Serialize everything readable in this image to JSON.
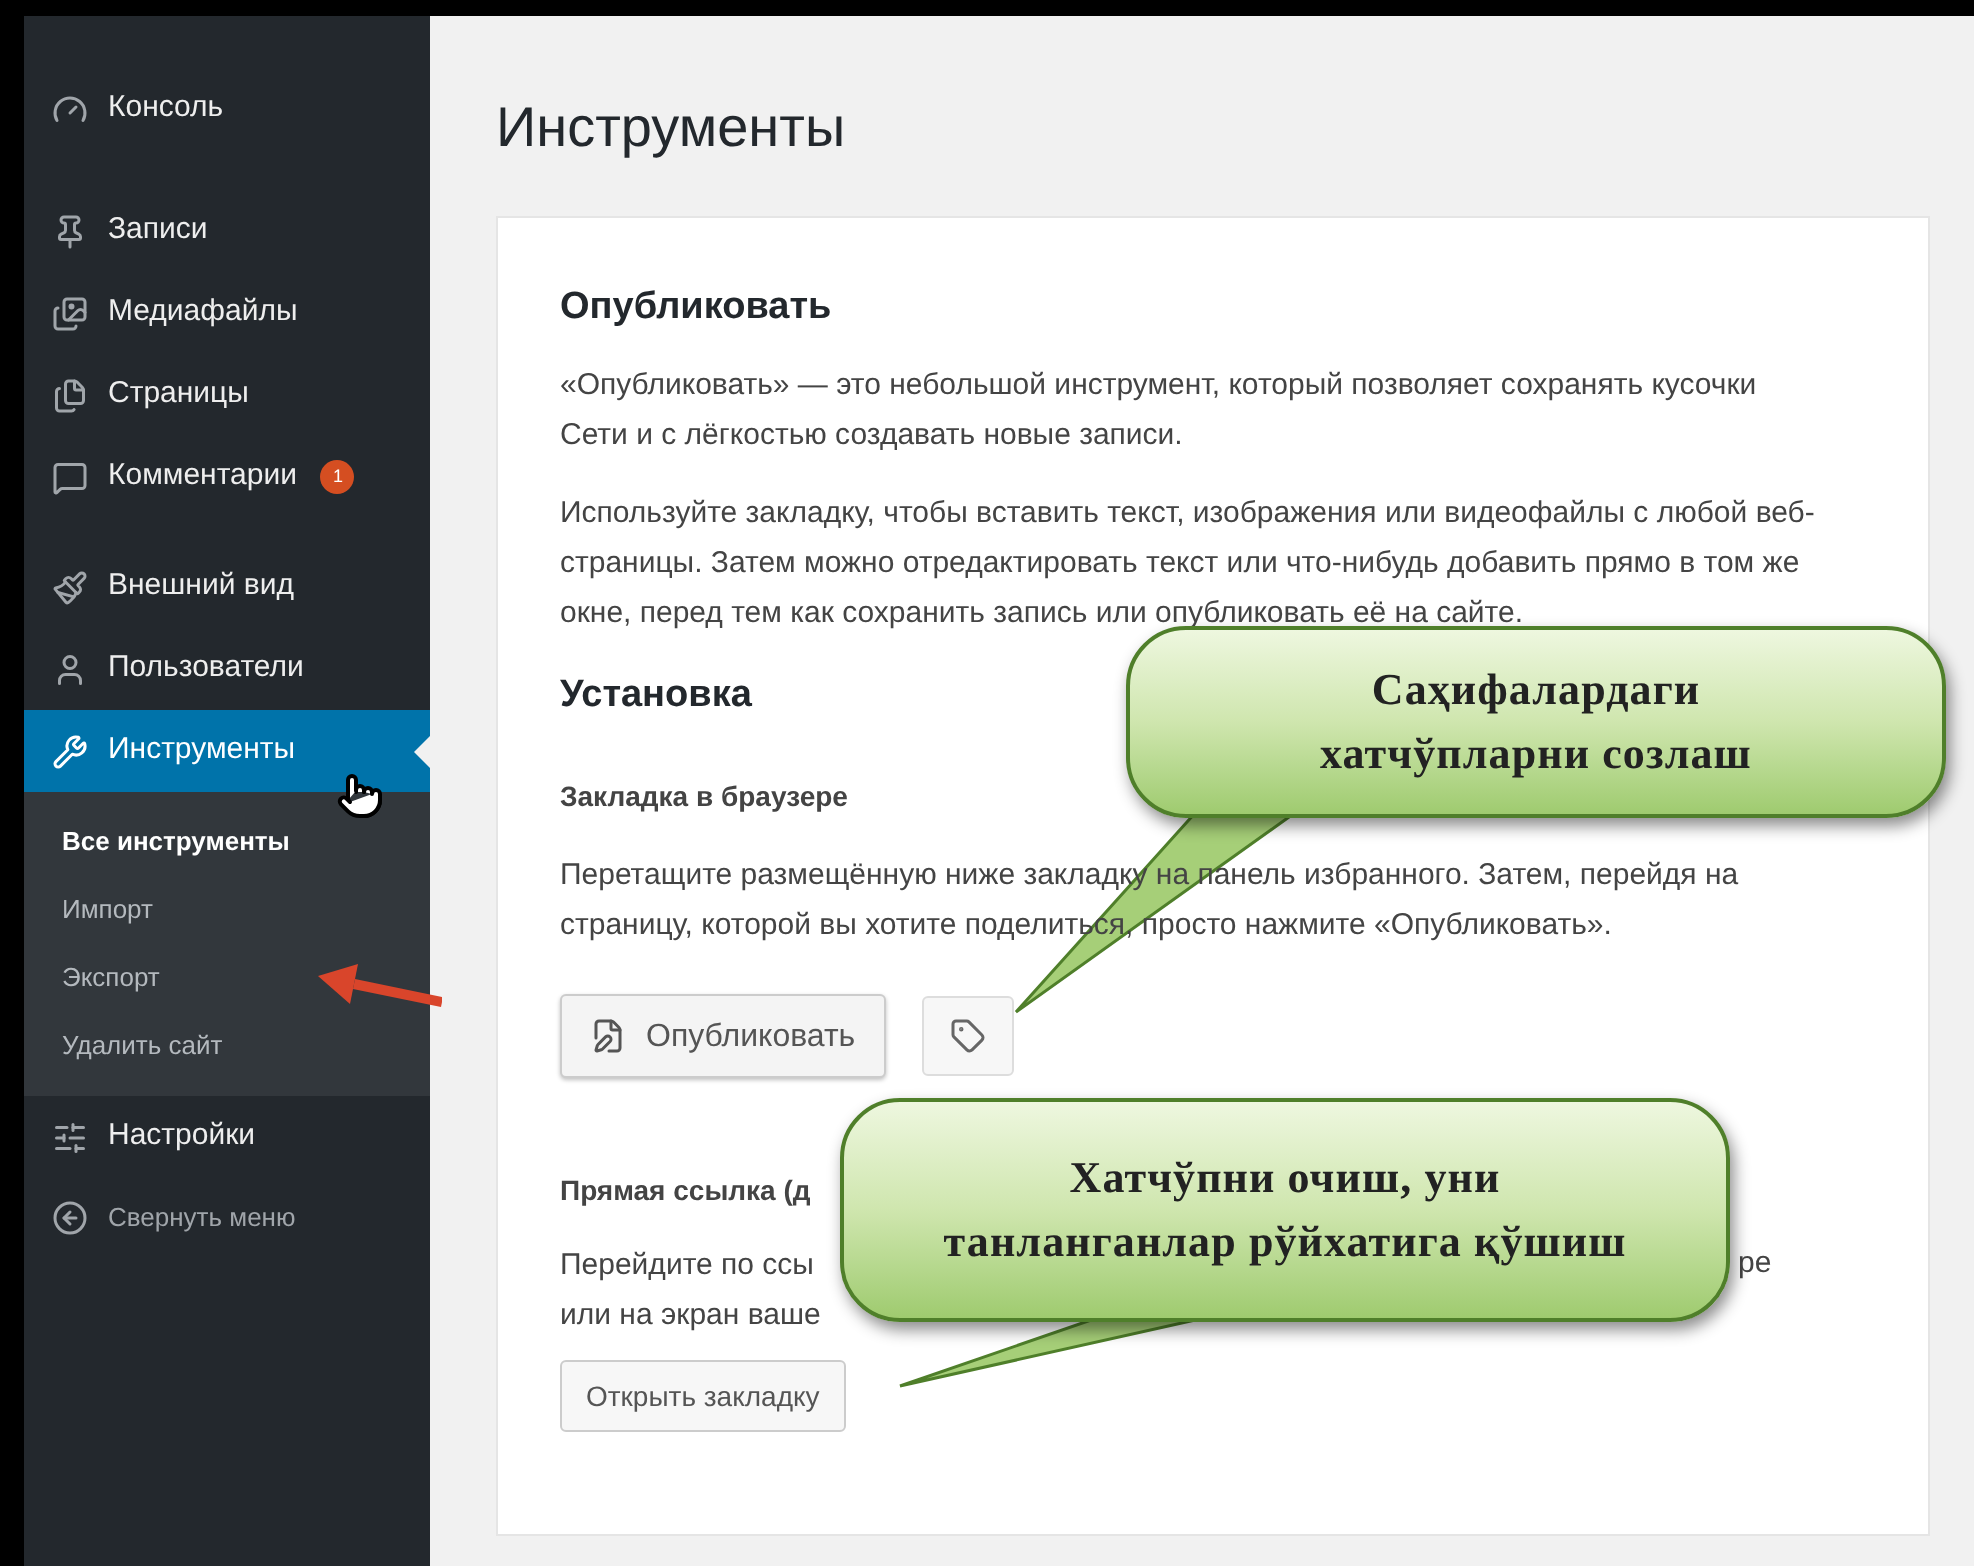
{
  "sidebar": {
    "items": [
      {
        "label": "Консоль",
        "selected": false
      },
      {
        "label": "Записи",
        "selected": false
      },
      {
        "label": "Медиафайлы",
        "selected": false
      },
      {
        "label": "Страницы",
        "selected": false
      },
      {
        "label": "Комментарии",
        "selected": false,
        "badge": "1"
      },
      {
        "label": "Внешний вид",
        "selected": false
      },
      {
        "label": "Пользователи",
        "selected": false
      },
      {
        "label": "Инструменты",
        "selected": true,
        "children": [
          {
            "label": "Все инструменты",
            "selected": true
          },
          {
            "label": "Импорт",
            "selected": false
          },
          {
            "label": "Экспорт",
            "selected": false
          },
          {
            "label": "Удалить сайт",
            "selected": false
          }
        ]
      },
      {
        "label": "Настройки",
        "selected": false
      }
    ],
    "collapse": "Свернуть меню"
  },
  "page_title": "Инструменты",
  "publish": {
    "heading": "Опубликовать",
    "paragraphs": [
      "«Опубликовать» — это небольшой инструмент, который позволяет сохранять кусочки Сети и с лёгкостью создавать новые записи.",
      "Используйте закладку, чтобы вставить текст, изображения или видеофайлы с любой веб-страницы. Затем можно отредактировать текст или что-нибудь добавить прямо в том же окне, перед тем как сохранить запись или опубликовать её на сайте."
    ]
  },
  "install": {
    "heading": "Установка",
    "bookmarklet": {
      "heading": "Закладка в браузере",
      "text": "Перетащите размещённую ниже закладку на панель избранного. Затем, перейдя на страницу, которой вы хотите поделиться, просто нажмите «Опубликовать».",
      "button": "Опубликовать"
    },
    "direct_link": {
      "heading": "Прямая ссылка (д",
      "lines": [
        "Перейдите по ссы",
        "или на экран ваше"
      ],
      "line_end": "ре",
      "button": "Открыть закладку"
    }
  },
  "callouts": [
    {
      "lines": [
        "Саҳифалардаги",
        "хатчўпларни созлаш"
      ]
    },
    {
      "lines": [
        "Хатчўпни очиш, уни",
        "танланганлар рўйхатига қўшиш"
      ]
    }
  ]
}
